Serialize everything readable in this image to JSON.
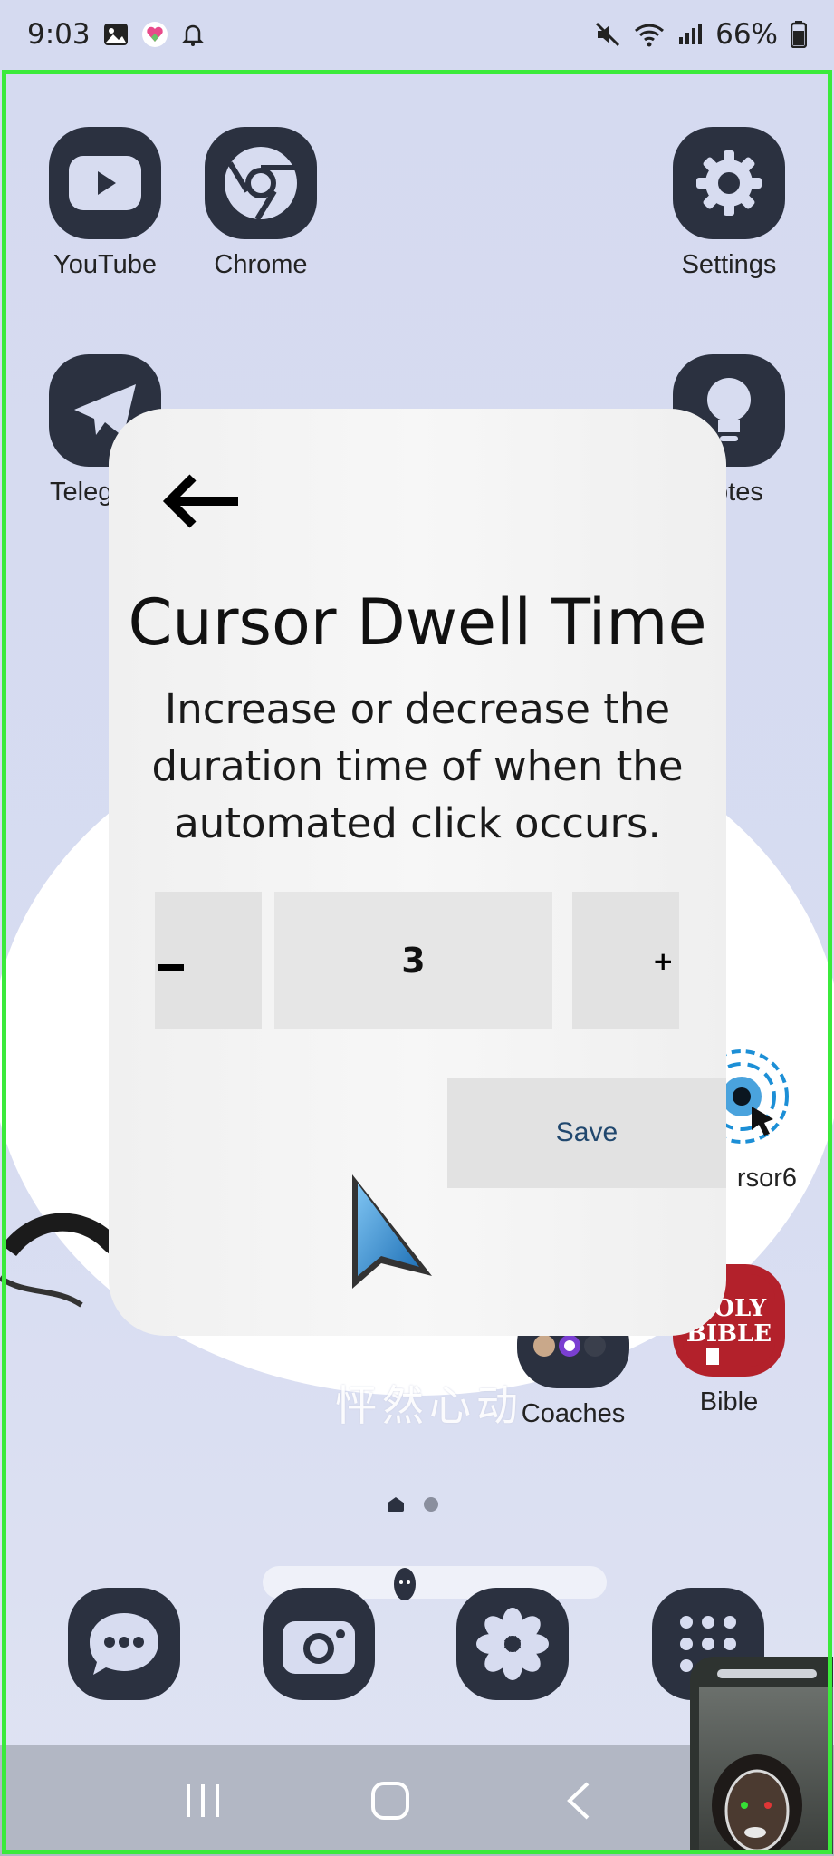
{
  "status_bar": {
    "time": "9:03",
    "battery": "66%"
  },
  "apps": {
    "youtube": "YouTube",
    "chrome": "Chrome",
    "settings": "Settings",
    "telegram": "Teleg",
    "notes": "Notes",
    "cursor": "rsor6",
    "coaches": "Coaches",
    "bible": "Bible"
  },
  "dialog": {
    "title": "Cursor Dwell Time",
    "description": "Increase or decrease the duration time of when the automated click occurs.",
    "value": "3",
    "plus_label": "+",
    "save_label": "Save"
  },
  "colors": {
    "frame_border": "#3bea3b",
    "icon_bg": "#2b3140",
    "save_text": "#21486e"
  },
  "icons": [
    "gallery-icon",
    "chat-heart-icon",
    "bell-icon",
    "mute-icon",
    "wifi-icon",
    "signal-icon",
    "battery-icon",
    "back-arrow-icon",
    "home-nav-icon",
    "recents-nav-icon",
    "back-nav-icon"
  ]
}
